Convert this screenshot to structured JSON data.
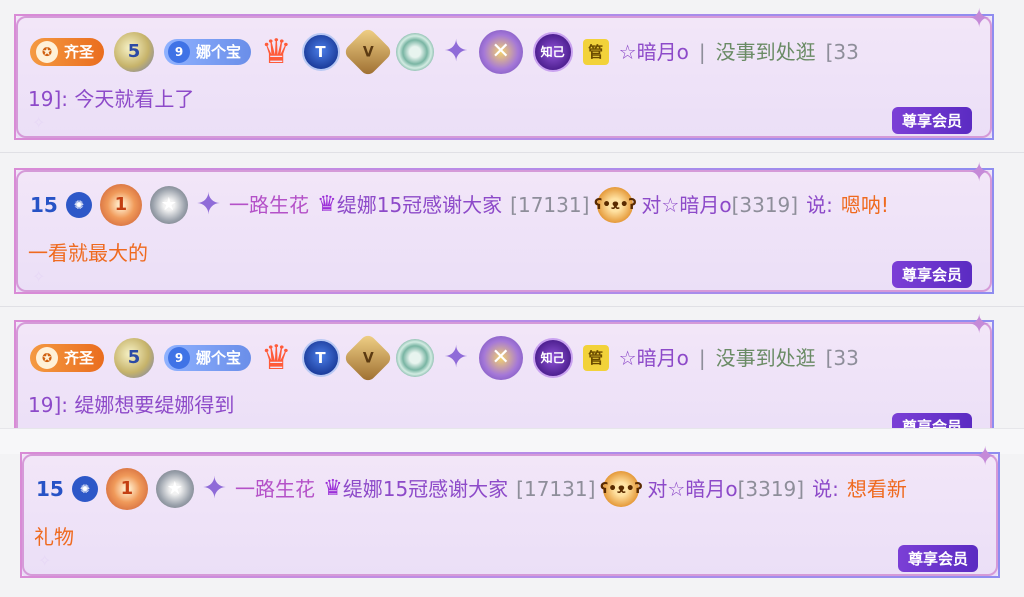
{
  "messages": [
    {
      "tag_label": "齐圣",
      "level_badge": "5",
      "heart_level": "9",
      "heart_label": "娜个宝",
      "crown_icon": "crown-icon",
      "shield_label": "T",
      "gold_label": "V",
      "purple_label": "知己",
      "admin_label": "管",
      "sender": "☆暗月o",
      "separator": "|",
      "text_line1": "没事到处逛",
      "bracket_open": "[33",
      "bracket_close": "19]",
      "colon": ":",
      "content": "今天就看上了",
      "vip_label": "尊享会员"
    },
    {
      "level_num": "15",
      "rank_num": "1",
      "sender_prefix": "一路生花",
      "sender_main": "缇娜15冠感谢大家",
      "sender_id": "[17131]",
      "to_word": "对",
      "target": "☆暗月o",
      "target_id": "[3319]",
      "say_word": "说:",
      "content_part1": "嗯呐!",
      "content_part2": "一看就最大的",
      "vip_label": "尊享会员"
    },
    {
      "tag_label": "齐圣",
      "level_badge": "5",
      "heart_level": "9",
      "heart_label": "娜个宝",
      "shield_label": "T",
      "gold_label": "V",
      "purple_label": "知己",
      "admin_label": "管",
      "sender": "☆暗月o",
      "separator": "|",
      "text_line1": "没事到处逛",
      "bracket_open": "[33",
      "bracket_close": "19]",
      "colon": ":",
      "content": "缇娜想要缇娜得到",
      "vip_label": "尊享会员"
    },
    {
      "level_num": "15",
      "rank_num": "1",
      "sender_prefix": "一路生花",
      "sender_main": "缇娜15冠感谢大家",
      "sender_id": "[17131]",
      "to_word": "对",
      "target": "☆暗月o",
      "target_id": "[3319]",
      "say_word": "说:",
      "content_part1": "想看新",
      "content_part2": "礼物",
      "vip_label": "尊享会员"
    }
  ],
  "colors": {
    "vip_bg": "#6a35cf",
    "card_border": "#d59ad8",
    "orange_text": "#ef6a1f",
    "purple_text": "#8d4ac9"
  }
}
